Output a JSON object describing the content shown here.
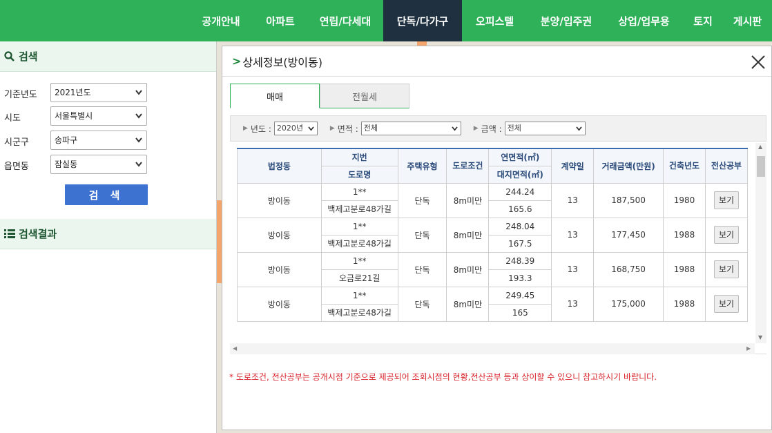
{
  "nav": {
    "items": [
      {
        "label": "공개안내",
        "active": false
      },
      {
        "label": "아파트",
        "active": false
      },
      {
        "label": "연립/다세대",
        "active": false
      },
      {
        "label": "단독/다가구",
        "active": true
      },
      {
        "label": "오피스텔",
        "active": false
      },
      {
        "label": "분양/입주권",
        "active": false
      },
      {
        "label": "상업/업무용",
        "active": false
      },
      {
        "label": "토지",
        "active": false
      },
      {
        "label": "게시판",
        "active": false
      }
    ]
  },
  "left": {
    "search_title": "검색",
    "fields": [
      {
        "label": "기준년도",
        "value": "2021년도"
      },
      {
        "label": "시도",
        "value": "서울특별시"
      },
      {
        "label": "시군구",
        "value": "송파구"
      },
      {
        "label": "읍면동",
        "value": "잠실동"
      }
    ],
    "search_button": "검 색",
    "results_title": "검색결과"
  },
  "modal": {
    "title": "상세정보(방이동)",
    "tabs": [
      "매매",
      "전월세"
    ],
    "filters": {
      "year_label": "년도 :",
      "year_value": "2020년",
      "area_label": "면적 :",
      "area_value": "전체",
      "amount_label": "금액 :",
      "amount_value": "전체"
    },
    "columns": {
      "dong": "법정동",
      "jibun": "지번",
      "road": "도로명",
      "type": "주택유형",
      "road_cond": "도로조건",
      "floor_area": "연면적(㎡)",
      "land_area": "대지면적(㎡)",
      "contract_day": "계약일",
      "price": "거래금액(만원)",
      "built_year": "건축년도",
      "ledger": "전산공부"
    },
    "rows": [
      {
        "dong": "방이동",
        "jibun": "1**",
        "road": "백제고분로48가길",
        "type": "단독",
        "road_cond": "8m미만",
        "floor_area": "244.24",
        "land_area": "165.6",
        "day": "13",
        "price": "187,500",
        "year": "1980",
        "btn": "보기"
      },
      {
        "dong": "방이동",
        "jibun": "1**",
        "road": "백제고분로48가길",
        "type": "단독",
        "road_cond": "8m미만",
        "floor_area": "248.04",
        "land_area": "167.5",
        "day": "13",
        "price": "177,450",
        "year": "1988",
        "btn": "보기"
      },
      {
        "dong": "방이동",
        "jibun": "1**",
        "road": "오금로21길",
        "type": "단독",
        "road_cond": "8m미만",
        "floor_area": "248.39",
        "land_area": "193.3",
        "day": "13",
        "price": "168,750",
        "year": "1988",
        "btn": "보기"
      },
      {
        "dong": "방이동",
        "jibun": "1**",
        "road": "백제고분로48가길",
        "type": "단독",
        "road_cond": "8m미만",
        "floor_area": "249.45",
        "land_area": "165",
        "day": "13",
        "price": "175,000",
        "year": "1988",
        "btn": "보기"
      }
    ],
    "note": "* 도로조건, 전산공부는 공개시점 기준으로 제공되어 조회시점의 현황,전산공부 등과 상이할 수 있으니 참고하시기 바랍니다."
  },
  "colors": {
    "brand_green": "#2fb15a",
    "active_nav": "#1f3140",
    "search_button": "#3d72d1",
    "note_red": "#d8222a"
  }
}
